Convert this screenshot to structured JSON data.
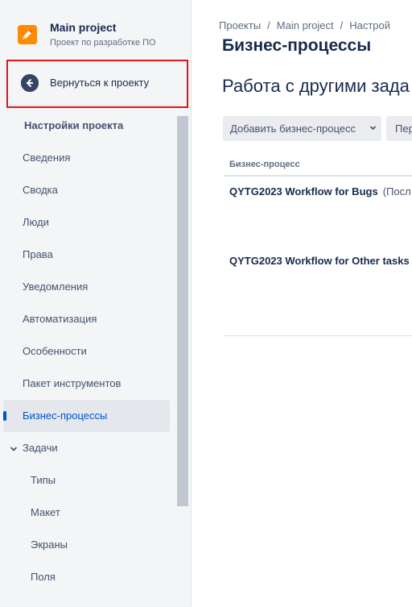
{
  "sidebar": {
    "project_name": "Main project",
    "project_type": "Проект по разработке ПО",
    "back_label": "Вернуться к проекту",
    "settings_title": "Настройки проекта",
    "items": [
      {
        "label": "Сведения"
      },
      {
        "label": "Сводка"
      },
      {
        "label": "Люди"
      },
      {
        "label": "Права"
      },
      {
        "label": "Уведомления"
      },
      {
        "label": "Автоматизация"
      },
      {
        "label": "Особенности"
      },
      {
        "label": "Пакет инструментов"
      },
      {
        "label": "Бизнес-процессы"
      },
      {
        "label": "Задачи"
      },
      {
        "label": "Типы"
      },
      {
        "label": "Макет"
      },
      {
        "label": "Экраны"
      },
      {
        "label": "Поля"
      }
    ],
    "active_item": "Бизнес-процессы",
    "accent_color": "#0052cc",
    "highlight_color": "#e01616"
  },
  "main": {
    "breadcrumb": [
      "Проекты",
      "Main project",
      "Настрой"
    ],
    "title": "Бизнес-процессы",
    "section_heading": "Работа с другими зада",
    "add_button_label": "Добавить бизнес-процесс",
    "second_button_label": "Пер",
    "table": {
      "header": "Бизнес-процесс",
      "rows": [
        {
          "name": "QYTG2023 Workflow for Bugs",
          "extra": "(Посл"
        },
        {
          "name": "QYTG2023 Workflow for Other tasks",
          "extra": ""
        }
      ]
    }
  }
}
